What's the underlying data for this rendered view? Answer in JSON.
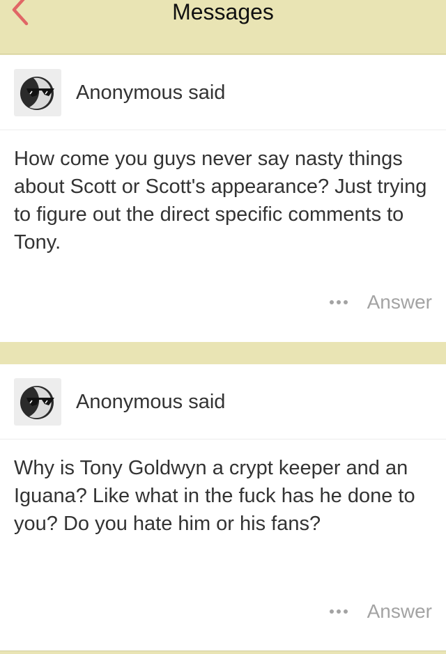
{
  "header": {
    "title": "Messages",
    "back_icon": "chevron-left-icon",
    "back_color": "#e06666"
  },
  "messages": [
    {
      "author": "Anonymous said",
      "avatar_icon": "anonymous-sunglasses-icon",
      "text": "How come you guys never say nasty things about Scott or Scott's appearance? Just trying to figure out the direct specific comments to Tony.",
      "more_icon": "more-dots-icon",
      "answer_label": "Answer"
    },
    {
      "author": "Anonymous said",
      "avatar_icon": "anonymous-sunglasses-icon",
      "text": "Why is Tony Goldwyn a crypt keeper and an Iguana? Like what in the fuck has he done to you? Do you hate him or his fans?",
      "more_icon": "more-dots-icon",
      "answer_label": "Answer"
    }
  ],
  "colors": {
    "background": "#e9e4b4",
    "card": "#ffffff",
    "muted": "#a3a3a3"
  }
}
